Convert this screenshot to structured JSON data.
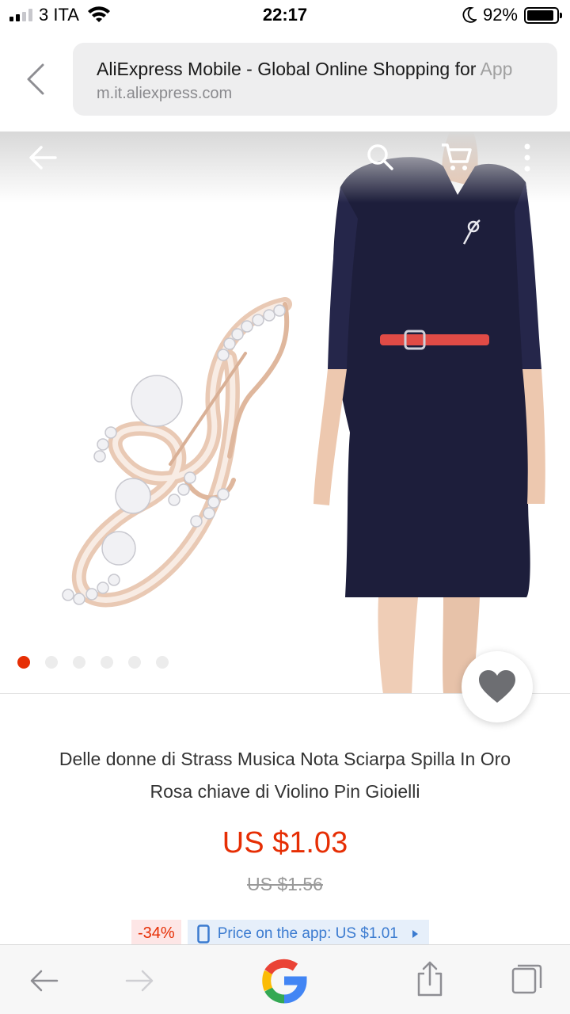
{
  "status_bar": {
    "carrier": "3 ITA",
    "time": "22:17",
    "battery_percent": "92%",
    "battery_level": 0.92,
    "signal_bars": 2
  },
  "browser": {
    "page_title": "AliExpress Mobile - Global Online Shopping for App",
    "page_title_visible": "AliExpress Mobile - Global Online Shopping for ",
    "page_title_faded": "App",
    "domain": "m.it.aliexpress.com"
  },
  "gallery": {
    "image_count": 6,
    "active_index": 0,
    "icons": [
      "back-arrow-icon",
      "search-icon",
      "cart-icon",
      "more-icon",
      "heart-icon"
    ]
  },
  "product": {
    "title_line1": "Delle donne di Strass Musica Nota Sciarpa Spilla In Oro",
    "title_line2": "Rosa chiave di Violino Pin Gioielli",
    "price": "US $1.03",
    "original_price": "US $1.56",
    "discount": "-34%",
    "app_price": "Price on the app: US $1.01"
  },
  "colors": {
    "accent": "#e62e04",
    "app_price_text": "#3b7bd0",
    "dress": "#1d1e3b",
    "belt": "#e04b46"
  }
}
